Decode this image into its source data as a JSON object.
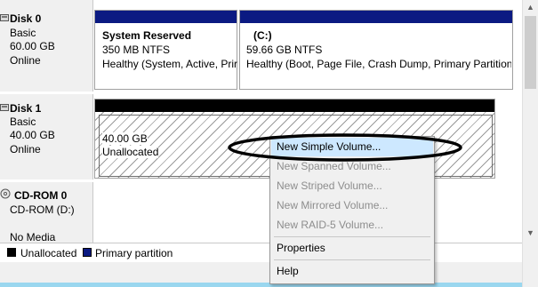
{
  "disk0": {
    "name": "Disk 0",
    "type": "Basic",
    "size": "60.00 GB",
    "status": "Online"
  },
  "disk0_partitions": [
    {
      "title": "System Reserved",
      "line1": "350 MB NTFS",
      "line2": "Healthy (System, Active, Prir"
    },
    {
      "title": "(C:)",
      "line1": "59.66 GB NTFS",
      "line2": "Healthy (Boot, Page File, Crash Dump, Primary Partition"
    }
  ],
  "disk1": {
    "name": "Disk 1",
    "type": "Basic",
    "size": "40.00 GB",
    "status": "Online"
  },
  "disk1_partition": {
    "size": "40.00 GB",
    "status": "Unallocated"
  },
  "cdrom0": {
    "name": "CD-ROM 0",
    "type": "CD-ROM (D:)",
    "status": "No Media"
  },
  "legend": {
    "unallocated": "Unallocated",
    "primary": "Primary partition"
  },
  "context_menu": {
    "items": [
      {
        "label": "New Simple Volume...",
        "enabled": true
      },
      {
        "label": "New Spanned Volume...",
        "enabled": false
      },
      {
        "label": "New Striped Volume...",
        "enabled": false
      },
      {
        "label": "New Mirrored Volume...",
        "enabled": false
      },
      {
        "label": "New RAID-5 Volume...",
        "enabled": false
      },
      {
        "label": "Properties",
        "enabled": true
      },
      {
        "label": "Help",
        "enabled": true
      }
    ]
  },
  "colors": {
    "primary_partition": "#0b1a82",
    "unallocated": "#000000",
    "highlight": "#cde8ff",
    "annotation_ellipse": "#000000"
  }
}
